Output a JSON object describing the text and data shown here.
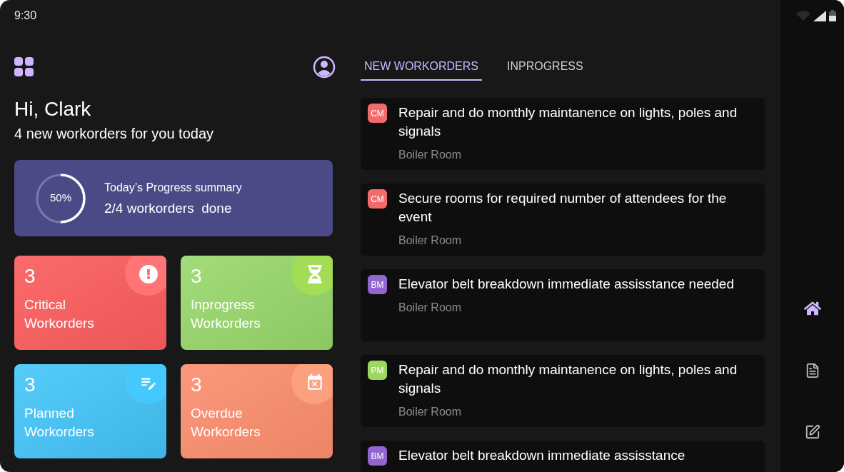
{
  "status_bar": {
    "time": "9:30"
  },
  "greeting": {
    "title": "Hi, Clark",
    "subtitle": "4 new workorders for you today"
  },
  "summary": {
    "reading": "50%",
    "level": 0.5,
    "title": "Today’s Progress summary",
    "detail": "2/4 workorders  done"
  },
  "tiles": [
    {
      "kind": "critical",
      "count": "3",
      "label": "Critical Workorders"
    },
    {
      "kind": "inprogress",
      "count": "3",
      "label": "Inprogress Workorders"
    },
    {
      "kind": "planned",
      "count": "3",
      "label": "Planned Workorders"
    },
    {
      "kind": "overdue",
      "count": "3",
      "label": "Overdue Workorders"
    }
  ],
  "tabs": [
    {
      "label": "NEW WORKORDERS",
      "selected": true
    },
    {
      "label": "INPROGRESS",
      "selected": false
    }
  ],
  "workorders": [
    {
      "tag": "CM",
      "color": "#f26b6b",
      "title": "Repair and do monthly maintanence on lights, poles and signals",
      "location": "Boiler Room"
    },
    {
      "tag": "CM",
      "color": "#f26b6b",
      "title": "Secure rooms for required number of attendees for the event",
      "location": "Boiler Room"
    },
    {
      "tag": "BM",
      "color": "#9265d1",
      "title": "Elevator belt breakdown immediate assisstance needed",
      "location": "Boiler Room"
    },
    {
      "tag": "PM",
      "color": "#9fd65c",
      "title": "Repair and do monthly maintanence on lights, poles and signals",
      "location": "Boiler Room"
    },
    {
      "tag": "BM",
      "color": "#9265d1",
      "title": "Elevator belt breakdown immediate assisstance"
    }
  ],
  "nav": [
    {
      "kind": "home",
      "selected": true
    },
    {
      "kind": "document",
      "selected": false
    },
    {
      "kind": "edit",
      "selected": false
    }
  ]
}
